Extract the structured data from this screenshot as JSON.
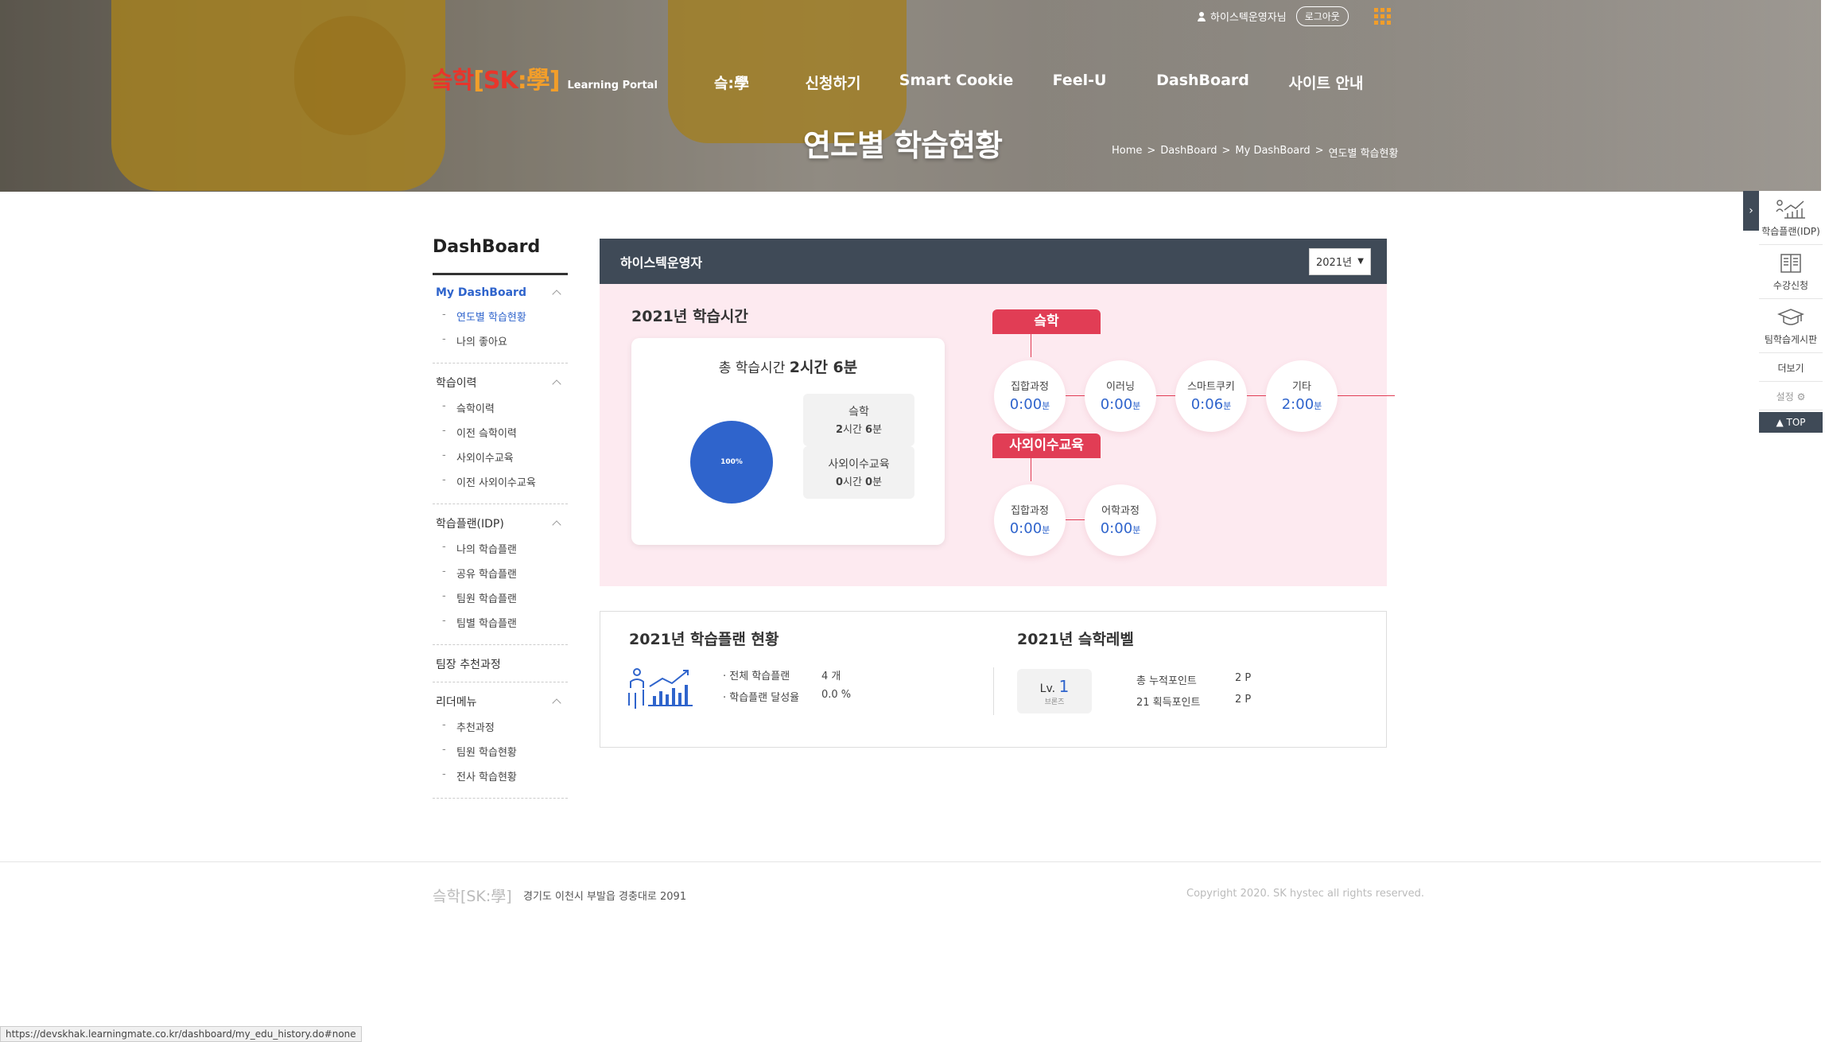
{
  "header": {
    "user_name": "하이스텍운영자님",
    "logout_label": "로그아웃",
    "logo": {
      "part1": "슼학",
      "part2_open": "[",
      "part2_sk": "SK",
      "part2_colon": ":",
      "part2_hak": "學",
      "part2_close": "]",
      "sub": "Learning Portal"
    },
    "nav": [
      "슼:學",
      "신청하기",
      "Smart Cookie",
      "Feel-U",
      "DashBoard",
      "사이트 안내"
    ],
    "page_title": "연도별 학습현황",
    "breadcrumb": [
      "Home",
      ">",
      "DashBoard",
      ">",
      "My DashBoard",
      ">",
      "연도별 학습현황"
    ]
  },
  "sidebar": {
    "title": "DashBoard",
    "groups": [
      {
        "label": "My DashBoard",
        "items": [
          "연도별 학습현황",
          "나의 좋아요"
        ]
      },
      {
        "label": "학습이력",
        "items": [
          "슼학이력",
          "이전 슼학이력",
          "사외이수교육",
          "이전 사외이수교육"
        ]
      },
      {
        "label": "학습플랜(IDP)",
        "items": [
          "나의 학습플랜",
          "공유 학습플랜",
          "팀원 학습플랜",
          "팀별 학습플랜"
        ]
      },
      {
        "label": "팀장 추천과정",
        "items": []
      },
      {
        "label": "리더메뉴",
        "items": [
          "추천과정",
          "팀원 학습현황",
          "전사 학습현황"
        ]
      }
    ]
  },
  "panel": {
    "head_title": "하이스텍운영자",
    "year_selected": "2021년",
    "time_title": "2021년 학습시간",
    "total_label": "총 학습시간",
    "total_value": "2시간 6분",
    "pie_label": "100%",
    "pie_share": 1.0,
    "box1": {
      "label": "슼학",
      "h": "2",
      "h_unit": "시간",
      "m": "6",
      "m_unit": "분"
    },
    "box2": {
      "label": "사외이수교육",
      "h": "0",
      "h_unit": "시간",
      "m": "0",
      "m_unit": "분"
    },
    "cat1": {
      "label": "슼학",
      "items": [
        {
          "label": "집합과정",
          "value": "0:00",
          "unit": "분"
        },
        {
          "label": "이러닝",
          "value": "0:00",
          "unit": "분"
        },
        {
          "label": "스마트쿠키",
          "value": "0:06",
          "unit": "분"
        },
        {
          "label": "기타",
          "value": "2:00",
          "unit": "분"
        }
      ]
    },
    "cat2": {
      "label": "사외이수교육",
      "items": [
        {
          "label": "집합과정",
          "value": "0:00",
          "unit": "분"
        },
        {
          "label": "어학과정",
          "value": "0:00",
          "unit": "분"
        }
      ]
    },
    "plan_title": "2021년 학습플랜 현황",
    "plan_stats": [
      {
        "label": "전체 학습플랜",
        "value": "4 개"
      },
      {
        "label": "학습플랜 달성율",
        "value": "0.0 %"
      }
    ],
    "level_title": "2021년 슼학레벨",
    "level": {
      "prefix": "Lv.",
      "num": "1",
      "tier": "브론즈"
    },
    "points": [
      {
        "label": "총 누적포인트",
        "value": "2 P"
      },
      {
        "label": "21 획득포인트",
        "value": "2 P"
      }
    ]
  },
  "quick_menu": {
    "items": [
      "학습플랜(IDP)",
      "수강신청",
      "팀학습게시판",
      "더보기",
      "설정 ⚙"
    ],
    "top": "▲ TOP"
  },
  "footer": {
    "logo": "슼학[SK:學]",
    "address": "경기도 이천시 부발읍 경충대로 2091",
    "copyright": "Copyright 2020. SK hystec all rights reserved."
  },
  "status_url": "https://devskhak.learningmate.co.kr/dashboard/my_edu_history.do#none",
  "colors": {
    "accent_blue": "#2f64cc",
    "accent_red": "#e13d55",
    "header_dark": "#3f4a57",
    "pink_bg": "#fdeaf0"
  }
}
